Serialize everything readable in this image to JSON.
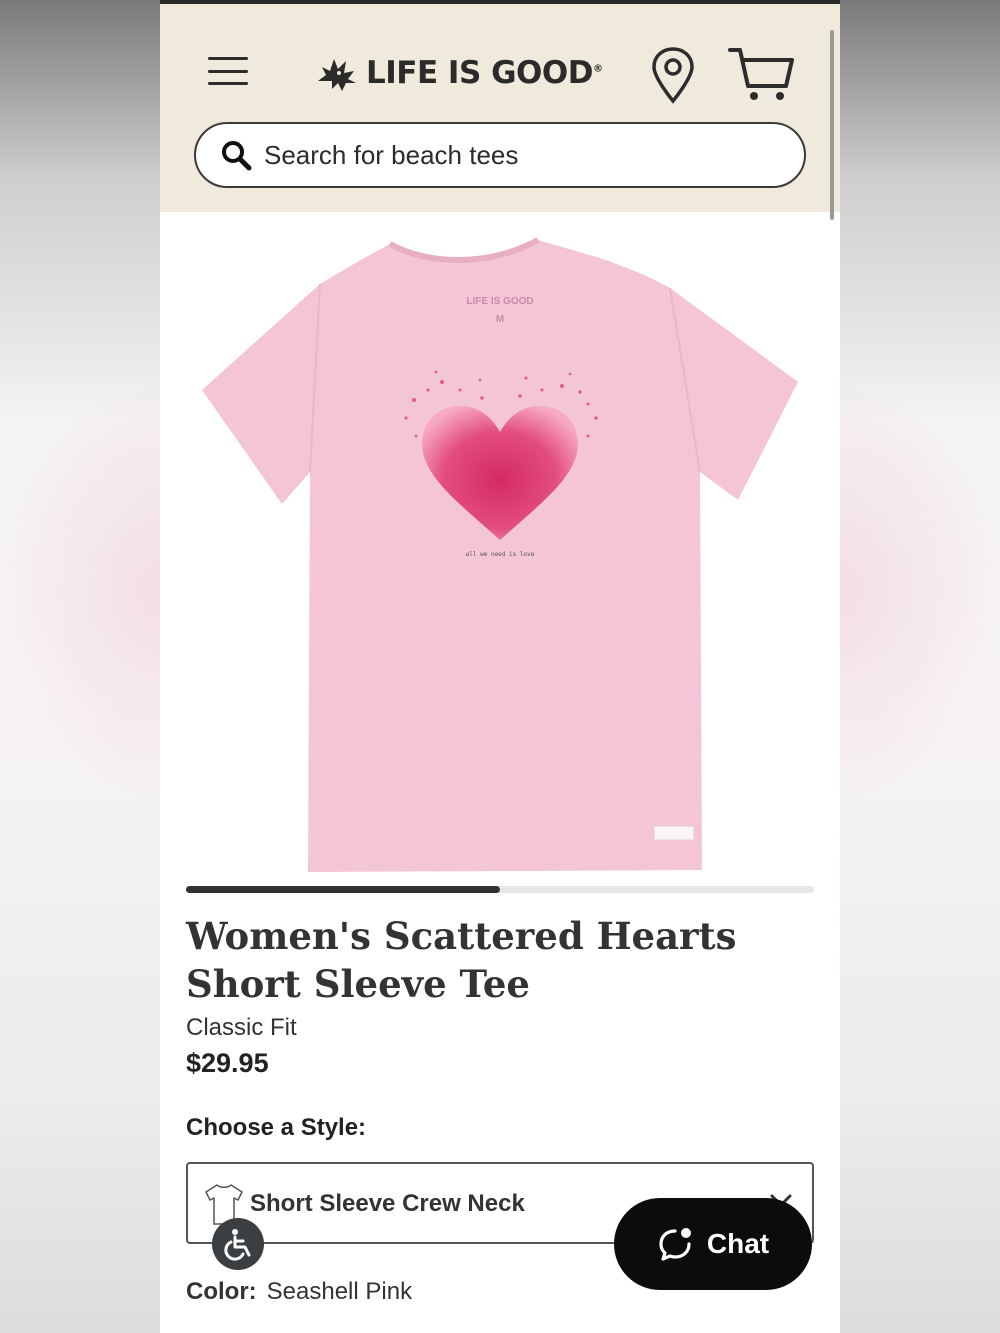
{
  "header": {
    "brand": "LIFE IS GOOD",
    "brand_mark": "®",
    "search_placeholder": "Search for beach tees",
    "icons": [
      "menu-icon",
      "location-pin-icon",
      "cart-icon",
      "search-icon"
    ]
  },
  "product_image": {
    "label_brand": "LIFE IS GOOD",
    "label_size": "M",
    "print_text": "all we need is love",
    "shirt_color": "#f4c6d8",
    "heart_color": "#e0336f"
  },
  "carousel": {
    "progress": 0.5
  },
  "product": {
    "title": "Women's Scattered Hearts Short Sleeve Tee",
    "fit": "Classic Fit",
    "price": "$29.95"
  },
  "style": {
    "label": "Choose a Style:",
    "selected": "Short Sleeve Crew Neck"
  },
  "color": {
    "label": "Color:",
    "value": "Seashell Pink"
  },
  "chat": {
    "label": "Chat"
  },
  "colors": {
    "header_bg": "#efeadb",
    "text": "#333333"
  }
}
